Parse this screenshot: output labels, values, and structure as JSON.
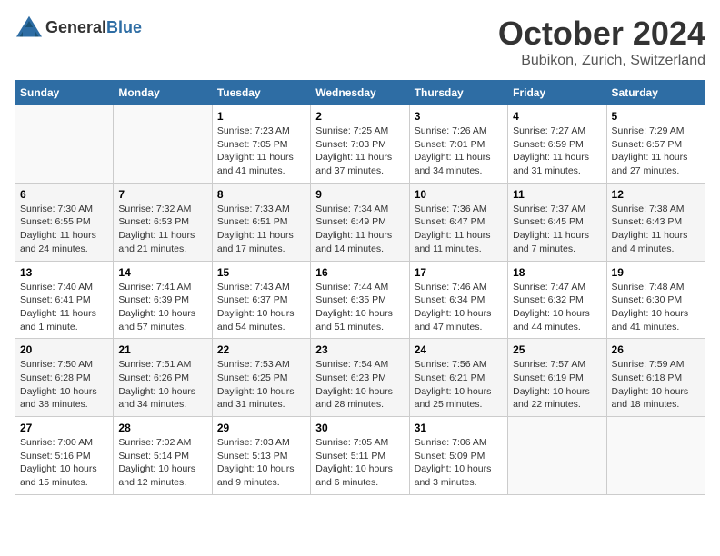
{
  "header": {
    "logo_general": "General",
    "logo_blue": "Blue",
    "month": "October 2024",
    "location": "Bubikon, Zurich, Switzerland"
  },
  "weekdays": [
    "Sunday",
    "Monday",
    "Tuesday",
    "Wednesday",
    "Thursday",
    "Friday",
    "Saturday"
  ],
  "weeks": [
    [
      {
        "day": "",
        "info": ""
      },
      {
        "day": "",
        "info": ""
      },
      {
        "day": "1",
        "sunrise": "7:23 AM",
        "sunset": "7:05 PM",
        "daylight": "11 hours and 41 minutes."
      },
      {
        "day": "2",
        "sunrise": "7:25 AM",
        "sunset": "7:03 PM",
        "daylight": "11 hours and 37 minutes."
      },
      {
        "day": "3",
        "sunrise": "7:26 AM",
        "sunset": "7:01 PM",
        "daylight": "11 hours and 34 minutes."
      },
      {
        "day": "4",
        "sunrise": "7:27 AM",
        "sunset": "6:59 PM",
        "daylight": "11 hours and 31 minutes."
      },
      {
        "day": "5",
        "sunrise": "7:29 AM",
        "sunset": "6:57 PM",
        "daylight": "11 hours and 27 minutes."
      }
    ],
    [
      {
        "day": "6",
        "sunrise": "7:30 AM",
        "sunset": "6:55 PM",
        "daylight": "11 hours and 24 minutes."
      },
      {
        "day": "7",
        "sunrise": "7:32 AM",
        "sunset": "6:53 PM",
        "daylight": "11 hours and 21 minutes."
      },
      {
        "day": "8",
        "sunrise": "7:33 AM",
        "sunset": "6:51 PM",
        "daylight": "11 hours and 17 minutes."
      },
      {
        "day": "9",
        "sunrise": "7:34 AM",
        "sunset": "6:49 PM",
        "daylight": "11 hours and 14 minutes."
      },
      {
        "day": "10",
        "sunrise": "7:36 AM",
        "sunset": "6:47 PM",
        "daylight": "11 hours and 11 minutes."
      },
      {
        "day": "11",
        "sunrise": "7:37 AM",
        "sunset": "6:45 PM",
        "daylight": "11 hours and 7 minutes."
      },
      {
        "day": "12",
        "sunrise": "7:38 AM",
        "sunset": "6:43 PM",
        "daylight": "11 hours and 4 minutes."
      }
    ],
    [
      {
        "day": "13",
        "sunrise": "7:40 AM",
        "sunset": "6:41 PM",
        "daylight": "11 hours and 1 minute."
      },
      {
        "day": "14",
        "sunrise": "7:41 AM",
        "sunset": "6:39 PM",
        "daylight": "10 hours and 57 minutes."
      },
      {
        "day": "15",
        "sunrise": "7:43 AM",
        "sunset": "6:37 PM",
        "daylight": "10 hours and 54 minutes."
      },
      {
        "day": "16",
        "sunrise": "7:44 AM",
        "sunset": "6:35 PM",
        "daylight": "10 hours and 51 minutes."
      },
      {
        "day": "17",
        "sunrise": "7:46 AM",
        "sunset": "6:34 PM",
        "daylight": "10 hours and 47 minutes."
      },
      {
        "day": "18",
        "sunrise": "7:47 AM",
        "sunset": "6:32 PM",
        "daylight": "10 hours and 44 minutes."
      },
      {
        "day": "19",
        "sunrise": "7:48 AM",
        "sunset": "6:30 PM",
        "daylight": "10 hours and 41 minutes."
      }
    ],
    [
      {
        "day": "20",
        "sunrise": "7:50 AM",
        "sunset": "6:28 PM",
        "daylight": "10 hours and 38 minutes."
      },
      {
        "day": "21",
        "sunrise": "7:51 AM",
        "sunset": "6:26 PM",
        "daylight": "10 hours and 34 minutes."
      },
      {
        "day": "22",
        "sunrise": "7:53 AM",
        "sunset": "6:25 PM",
        "daylight": "10 hours and 31 minutes."
      },
      {
        "day": "23",
        "sunrise": "7:54 AM",
        "sunset": "6:23 PM",
        "daylight": "10 hours and 28 minutes."
      },
      {
        "day": "24",
        "sunrise": "7:56 AM",
        "sunset": "6:21 PM",
        "daylight": "10 hours and 25 minutes."
      },
      {
        "day": "25",
        "sunrise": "7:57 AM",
        "sunset": "6:19 PM",
        "daylight": "10 hours and 22 minutes."
      },
      {
        "day": "26",
        "sunrise": "7:59 AM",
        "sunset": "6:18 PM",
        "daylight": "10 hours and 18 minutes."
      }
    ],
    [
      {
        "day": "27",
        "sunrise": "7:00 AM",
        "sunset": "5:16 PM",
        "daylight": "10 hours and 15 minutes."
      },
      {
        "day": "28",
        "sunrise": "7:02 AM",
        "sunset": "5:14 PM",
        "daylight": "10 hours and 12 minutes."
      },
      {
        "day": "29",
        "sunrise": "7:03 AM",
        "sunset": "5:13 PM",
        "daylight": "10 hours and 9 minutes."
      },
      {
        "day": "30",
        "sunrise": "7:05 AM",
        "sunset": "5:11 PM",
        "daylight": "10 hours and 6 minutes."
      },
      {
        "day": "31",
        "sunrise": "7:06 AM",
        "sunset": "5:09 PM",
        "daylight": "10 hours and 3 minutes."
      },
      {
        "day": "",
        "info": ""
      },
      {
        "day": "",
        "info": ""
      }
    ]
  ]
}
